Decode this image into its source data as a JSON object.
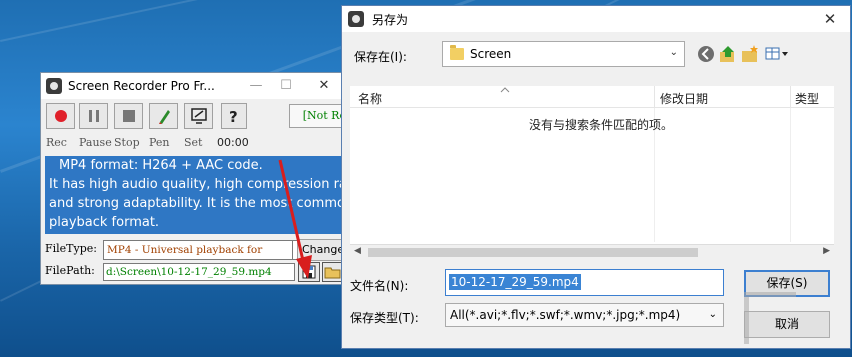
{
  "recorder": {
    "title": "Screen Recorder Pro Fr...",
    "not_reg": "[Not Reg]",
    "labels": [
      "Rec",
      "Pause",
      "Stop",
      "Pen",
      "Set"
    ],
    "timer": "00:00",
    "description": [
      "MP4 format: H264 + AAC code.",
      "It has high audio quality, high compression rate",
      "and strong adaptability. It is the most common",
      "playback format."
    ],
    "filetype_label": "FileType:",
    "filetype_value": "MP4 - Universal playback for",
    "change_label": "Change",
    "filepath_label": "FilePath:",
    "filepath_value": "d:\\Screen\\10-12-17_29_59.mp4"
  },
  "dialog": {
    "title": "另存为",
    "save_in_label": "保存在(I):",
    "save_in_value": "Screen",
    "columns": {
      "name": "名称",
      "modified": "修改日期",
      "type": "类型"
    },
    "empty_message": "没有与搜索条件匹配的项。",
    "filename_label": "文件名(N):",
    "filename_value": "10-12-17_29_59.mp4",
    "filetype_label": "保存类型(T):",
    "filetype_value": "All(*.avi;*.flv;*.swf;*.wmv;*.jpg;*.mp4)",
    "save_button": "保存(S)",
    "cancel_button": "取消"
  },
  "colors": {
    "rec_red": "#e0202a",
    "not_reg_green": "#008000",
    "selection_blue": "#2f77c4",
    "arrow_red": "#d81e1e"
  }
}
